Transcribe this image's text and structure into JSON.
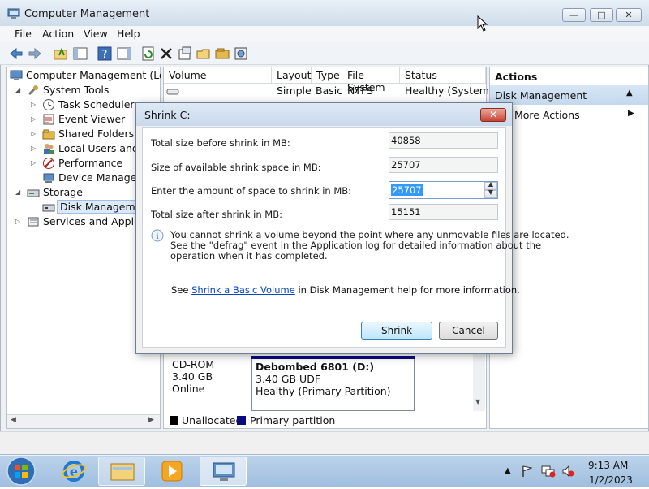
{
  "window": {
    "title": "Computer Management",
    "caption_min": "—",
    "caption_max": "□",
    "caption_close": "✕"
  },
  "menu": [
    "File",
    "Action",
    "View",
    "Help"
  ],
  "toolbar_icons": [
    "back-icon",
    "forward-icon",
    "up-folder-icon",
    "show-hide-console-tree-icon",
    "help-icon",
    "show-hide-action-pane-icon",
    "refresh-icon",
    "delete-icon",
    "properties-icon",
    "open-icon",
    "folder-icon",
    "disk-management-icon"
  ],
  "tree": {
    "root": "Computer Management (Local",
    "system_tools": "System Tools",
    "task_scheduler": "Task Scheduler",
    "event_viewer": "Event Viewer",
    "shared_folders": "Shared Folders",
    "local_users": "Local Users and Gr",
    "performance": "Performance",
    "device_manager": "Device Manager",
    "storage": "Storage",
    "disk_management": "Disk Management",
    "services": "Services and Applicati"
  },
  "volumes": {
    "headers": [
      "Volume",
      "Layout",
      "Type",
      "File System",
      "Status"
    ],
    "row": {
      "volume": "",
      "layout": "Simple",
      "type": "Basic",
      "fs": "NTFS",
      "status": "Healthy (System, A"
    }
  },
  "disk": {
    "cd_name": "CD-ROM",
    "cd_size": "3.40 GB",
    "cd_state": "Online",
    "part_name": "Debombed 6801  (D:)",
    "part_size": "3.40 GB UDF",
    "part_status": "Healthy (Primary Partition)"
  },
  "legend": {
    "unallocated": "Unallocated",
    "primary": "Primary partition",
    "unallocated_color": "#000000",
    "primary_color": "#0b0b80"
  },
  "actions": {
    "header": "Actions",
    "section": "Disk Management",
    "more": "More Actions"
  },
  "dialog": {
    "title": "Shrink C:",
    "close": "✕",
    "total_before_label": "Total size before shrink in MB:",
    "total_before_value": "40858",
    "available_label": "Size of available shrink space in MB:",
    "available_value": "25707",
    "amount_label": "Enter the amount of space to shrink in MB:",
    "amount_value": "25707",
    "after_label": "Total size after shrink in MB:",
    "after_value": "15151",
    "info_line1": "You cannot shrink a volume beyond the point where any unmovable files are located.",
    "info_line2": "See the \"defrag\" event in the Application log for detailed information about the",
    "info_line3": "operation when it has completed.",
    "see_prefix": "See ",
    "see_link": "Shrink a Basic Volume",
    "see_suffix": " in Disk Management help for more information.",
    "shrink_button": "Shrink",
    "cancel_button": "Cancel"
  },
  "taskbar": {
    "time": "9:13 AM",
    "date": "1/2/2023",
    "apps": [
      "start-orb-icon",
      "internet-explorer-icon",
      "file-explorer-icon",
      "media-player-icon",
      "computer-management-icon"
    ]
  }
}
